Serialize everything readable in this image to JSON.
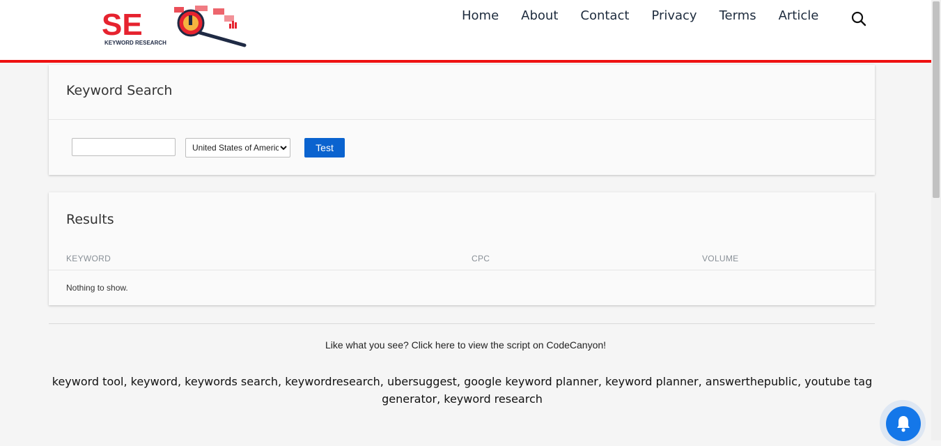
{
  "header": {
    "logo_text": "SEO",
    "logo_subtitle": "KEYWORD RESEARCH",
    "nav": [
      "Home",
      "About",
      "Contact",
      "Privacy",
      "Terms",
      "Article"
    ],
    "search_icon": "search-icon"
  },
  "keyword_search": {
    "title": "Keyword Search",
    "input_value": "",
    "input_placeholder": "",
    "country_selected": "United States of America",
    "test_button": "Test"
  },
  "results": {
    "title": "Results",
    "columns": [
      "KEYWORD",
      "CPC",
      "VOLUME"
    ],
    "empty_message": "Nothing to show."
  },
  "footer": {
    "codecanyon_text": "Like what you see? Click here to view the script on CodeCanyon!",
    "keywords_text": "keyword tool, keyword, keywords search, keywordresearch, ubersuggest, google keyword planner, keyword planner, answerthepublic, youtube tag generator, keyword research"
  },
  "colors": {
    "accent_red": "#ee1111",
    "button_blue": "#0a63cf",
    "bell_blue": "#1477e9"
  },
  "icons": {
    "bell": "bell-icon",
    "select_arrow": "chevron-down-icon"
  }
}
